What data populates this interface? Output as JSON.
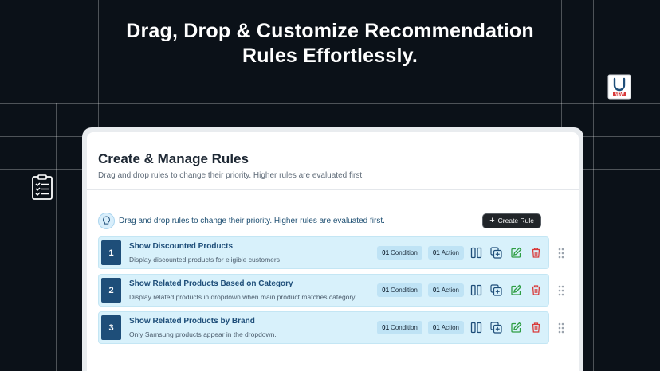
{
  "hero": {
    "line1": "Drag, Drop & Customize Recommendation",
    "line2": "Rules Effortlessly."
  },
  "icons": {
    "bag_badge": "NEW"
  },
  "panel": {
    "title": "Create & Manage Rules",
    "subtitle": "Drag and drop rules to change their priority. Higher rules are evaluated first.",
    "info_text": "Drag and drop rules to change their priority. Higher rules are evaluated first.",
    "create_button": "Create Rule",
    "rules": [
      {
        "number": "1",
        "title": "Show Discounted Products",
        "description": "Display discounted products for eligible customers",
        "condition_count": "01",
        "condition_label": "Condition",
        "action_count": "01",
        "action_label": "Action"
      },
      {
        "number": "2",
        "title": "Show Related Products Based on Category",
        "description": "Display related products in dropdown when main product matches category",
        "condition_count": "01",
        "condition_label": "Condition",
        "action_count": "01",
        "action_label": "Action"
      },
      {
        "number": "3",
        "title": "Show Related Products by Brand",
        "description": "Only Samsung products appear in the dropdown.",
        "condition_count": "01",
        "condition_label": "Condition",
        "action_count": "01",
        "action_label": "Action"
      }
    ]
  },
  "colors": {
    "background": "#0b1118",
    "rule_bg": "#d8f1fb",
    "rule_number_bg": "#1e4e79",
    "edit_icon": "#2f9e44",
    "delete_icon": "#d93a3a"
  }
}
